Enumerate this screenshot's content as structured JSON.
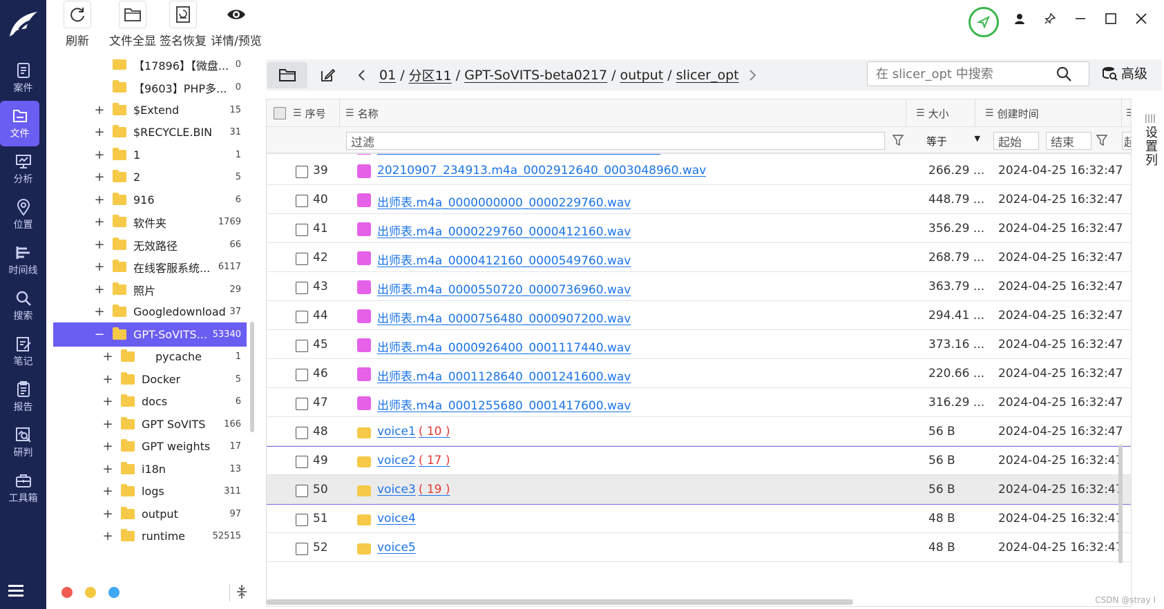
{
  "toolbar": {
    "buttons": [
      {
        "label": "刷新",
        "icon": "refresh-icon"
      },
      {
        "label": "文件全显",
        "icon": "folder-icon"
      },
      {
        "label": "签名恢复",
        "icon": "signature-restore-icon"
      },
      {
        "label": "详情/预览",
        "icon": "eye-icon"
      }
    ]
  },
  "rail": {
    "items": [
      {
        "label": "案件",
        "icon": "case-icon"
      },
      {
        "label": "文件",
        "icon": "file-icon",
        "active": true
      },
      {
        "label": "分析",
        "icon": "analysis-icon"
      },
      {
        "label": "位置",
        "icon": "location-icon"
      },
      {
        "label": "时间线",
        "icon": "timeline-icon"
      },
      {
        "label": "搜索",
        "icon": "search-icon"
      },
      {
        "label": "笔记",
        "icon": "note-icon"
      },
      {
        "label": "报告",
        "icon": "report-icon"
      },
      {
        "label": "研判",
        "icon": "judge-icon"
      },
      {
        "label": "工具箱",
        "icon": "toolbox-icon"
      }
    ]
  },
  "tree": {
    "rows": [
      {
        "label": "【17896】【微盘...",
        "count": "0",
        "level": 1,
        "exp": ""
      },
      {
        "label": "【9603】PHP多...",
        "count": "0",
        "level": 1,
        "exp": ""
      },
      {
        "label": "$Extend",
        "count": "15",
        "level": 1,
        "exp": "+"
      },
      {
        "label": "$RECYCLE.BIN",
        "count": "31",
        "level": 1,
        "exp": "+"
      },
      {
        "label": "1",
        "count": "1",
        "level": 1,
        "exp": "+"
      },
      {
        "label": "2",
        "count": "5",
        "level": 1,
        "exp": "+"
      },
      {
        "label": "916",
        "count": "6",
        "level": 1,
        "exp": "+"
      },
      {
        "label": "软件夹",
        "count": "1769",
        "level": 1,
        "exp": "+"
      },
      {
        "label": "无效路径",
        "count": "66",
        "level": 1,
        "exp": "+"
      },
      {
        "label": "在线客服系统...",
        "count": "6117",
        "level": 1,
        "exp": "+"
      },
      {
        "label": "照片",
        "count": "29",
        "level": 1,
        "exp": "+"
      },
      {
        "label": "Googledownload",
        "count": "37",
        "level": 1,
        "exp": "+"
      },
      {
        "label": "GPT-SoVITS...",
        "count": "53340",
        "level": 1,
        "exp": "−",
        "selected": true
      },
      {
        "label": "pycache",
        "count": "1",
        "level": 2,
        "exp": "+"
      },
      {
        "label": "Docker",
        "count": "5",
        "level": 2,
        "exp": "+"
      },
      {
        "label": "docs",
        "count": "6",
        "level": 2,
        "exp": "+"
      },
      {
        "label": "GPT SoVITS",
        "count": "166",
        "level": 2,
        "exp": "+"
      },
      {
        "label": "GPT weights",
        "count": "17",
        "level": 2,
        "exp": "+"
      },
      {
        "label": "i18n",
        "count": "13",
        "level": 2,
        "exp": "+"
      },
      {
        "label": "logs",
        "count": "311",
        "level": 2,
        "exp": "+"
      },
      {
        "label": "output",
        "count": "97",
        "level": 2,
        "exp": "+"
      },
      {
        "label": "runtime",
        "count": "52515",
        "level": 2,
        "exp": "+"
      }
    ]
  },
  "pathbar": {
    "crumbs": [
      "01",
      "分区11",
      "GPT-SoVITS-beta0217",
      "output",
      "slicer_opt"
    ],
    "search_placeholder": "在 slicer_opt 中搜索",
    "advanced_label": "高级"
  },
  "grid": {
    "columns": {
      "index": "序号",
      "name": "名称",
      "size": "大小",
      "created": "创建时间"
    },
    "filter": {
      "placeholder": "过滤",
      "size_op": "等于",
      "start": "起始",
      "end": "结束",
      "start2": "起"
    },
    "rows": [
      {
        "no": "39",
        "type": "audio",
        "name": "20210907_234913.m4a_0002912640_0003048960.wav",
        "count": "",
        "size": "266.29 ...",
        "time": "2024-04-25 16:32:47"
      },
      {
        "no": "40",
        "type": "audio",
        "name": "出师表.m4a_0000000000_0000229760.wav",
        "count": "",
        "size": "448.79 ...",
        "time": "2024-04-25 16:32:47"
      },
      {
        "no": "41",
        "type": "audio",
        "name": "出师表.m4a_0000229760_0000412160.wav",
        "count": "",
        "size": "356.29 ...",
        "time": "2024-04-25 16:32:47"
      },
      {
        "no": "42",
        "type": "audio",
        "name": "出师表.m4a_0000412160_0000549760.wav",
        "count": "",
        "size": "268.79 ...",
        "time": "2024-04-25 16:32:47"
      },
      {
        "no": "43",
        "type": "audio",
        "name": "出师表.m4a_0000550720_0000736960.wav",
        "count": "",
        "size": "363.79 ...",
        "time": "2024-04-25 16:32:47"
      },
      {
        "no": "44",
        "type": "audio",
        "name": "出师表.m4a_0000756480_0000907200.wav",
        "count": "",
        "size": "294.41 ...",
        "time": "2024-04-25 16:32:47"
      },
      {
        "no": "45",
        "type": "audio",
        "name": "出师表.m4a_0000926400_0001117440.wav",
        "count": "",
        "size": "373.16 ...",
        "time": "2024-04-25 16:32:47"
      },
      {
        "no": "46",
        "type": "audio",
        "name": "出师表.m4a_0001128640_0001241600.wav",
        "count": "",
        "size": "220.66 ...",
        "time": "2024-04-25 16:32:47"
      },
      {
        "no": "47",
        "type": "audio",
        "name": "出师表.m4a_0001255680_0001417600.wav",
        "count": "",
        "size": "316.29 ...",
        "time": "2024-04-25 16:32:47"
      },
      {
        "no": "48",
        "type": "dir",
        "name": "voice1",
        "count": "( 10 )",
        "size": "56 B",
        "time": "2024-04-25 16:32:47"
      },
      {
        "no": "49",
        "type": "dir",
        "name": "voice2",
        "count": "( 17 )",
        "size": "56 B",
        "time": "2024-04-25 16:32:47"
      },
      {
        "no": "50",
        "type": "dir",
        "name": "voice3",
        "count": "( 19 )",
        "size": "56 B",
        "time": "2024-04-25 16:32:47",
        "highlight": true
      },
      {
        "no": "51",
        "type": "dir",
        "name": "voice4",
        "count": "",
        "size": "48 B",
        "time": "2024-04-25 16:32:47"
      },
      {
        "no": "52",
        "type": "dir",
        "name": "voice5",
        "count": "",
        "size": "48 B",
        "time": "2024-04-25 16:32:47"
      }
    ]
  },
  "side_tab": {
    "label": "设置列"
  },
  "watermark": "CSDN @stray I",
  "colors": {
    "rail": "#1b2552",
    "accent": "#6a5df2",
    "link": "#1a73e8",
    "audio": "#e461e8",
    "folder": "#f7c948",
    "pin": "#3ab54a"
  }
}
